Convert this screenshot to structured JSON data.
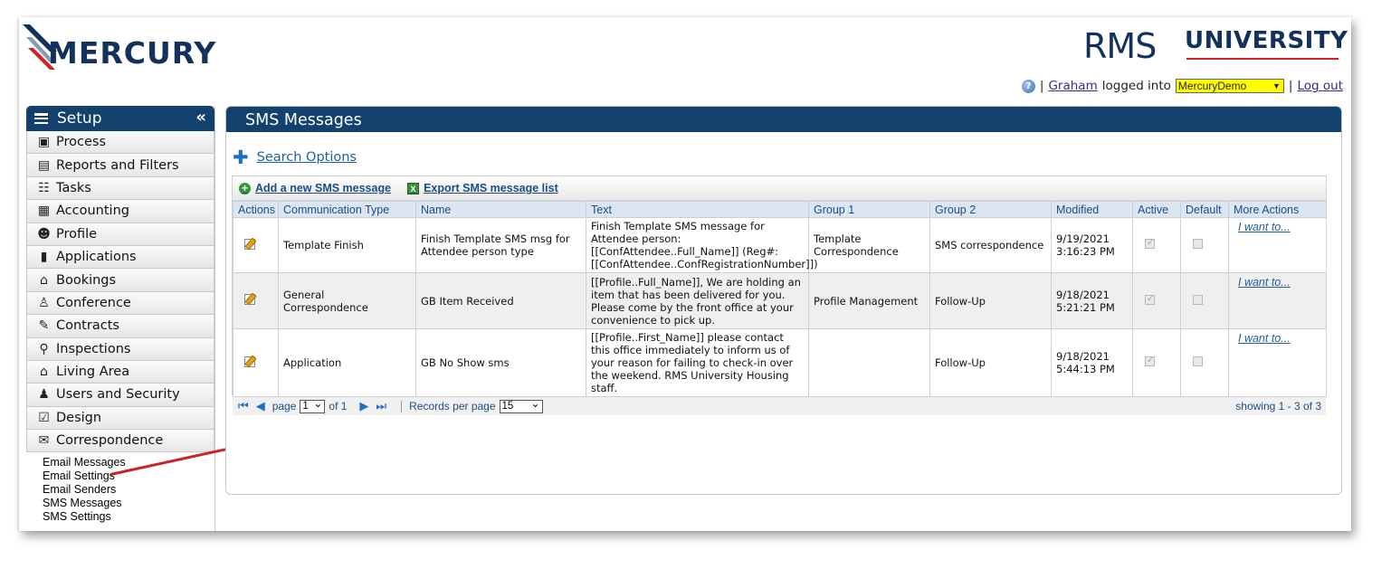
{
  "header": {
    "brand": "MERCURY",
    "partner_logo": "RMS",
    "partner_subtitle": "UNIVERSITY",
    "help_icon": "?",
    "user": "Graham",
    "logged_into": "logged into",
    "database": "MercuryDemo",
    "logout": "Log out",
    "separator": "|"
  },
  "sidebar": {
    "title": "Setup",
    "collapse_icon": "«",
    "items": [
      {
        "label": "Process",
        "icon": "process-icon"
      },
      {
        "label": "Reports and Filters",
        "icon": "report-icon"
      },
      {
        "label": "Tasks",
        "icon": "tasks-icon"
      },
      {
        "label": "Accounting",
        "icon": "calculator-icon"
      },
      {
        "label": "Profile",
        "icon": "people-icon"
      },
      {
        "label": "Applications",
        "icon": "clipboard-icon"
      },
      {
        "label": "Bookings",
        "icon": "house-icon"
      },
      {
        "label": "Conference",
        "icon": "group-icon"
      },
      {
        "label": "Contracts",
        "icon": "contract-icon"
      },
      {
        "label": "Inspections",
        "icon": "magnifier-icon"
      },
      {
        "label": "Living Area",
        "icon": "building-icon"
      },
      {
        "label": "Users and Security",
        "icon": "user-lock-icon"
      },
      {
        "label": "Design",
        "icon": "design-icon"
      },
      {
        "label": "Correspondence",
        "icon": "envelope-icon"
      }
    ],
    "sub_items": [
      "Email Messages",
      "Email Settings",
      "Email Senders",
      "SMS Messages",
      "SMS Settings"
    ]
  },
  "main": {
    "title": "SMS Messages",
    "search_options": "Search Options",
    "toolbar": {
      "add": "Add a new SMS message",
      "export": "Export SMS message list"
    },
    "columns": [
      "Actions",
      "Communication Type",
      "Name",
      "Text",
      "Group 1",
      "Group 2",
      "Modified",
      "Active",
      "Default",
      "More Actions"
    ],
    "rows": [
      {
        "type": "Template Finish",
        "name": "Finish Template SMS msg for Attendee person type",
        "text": "Finish Template SMS message for Attendee person:[[ConfAttendee..Full_Name]] (Reg#: [[ConfAttendee..ConfRegistrationNumber]])",
        "group1": "Template Correspondence",
        "group2": "SMS correspondence",
        "modified_date": "9/19/2021",
        "modified_time": "3:16:23 PM",
        "active": true,
        "default": false,
        "more": "I want to..."
      },
      {
        "type": "General Correspondence",
        "name": "GB Item Received",
        "text": "[[Profile..Full_Name]], We are holding an item that has been delivered for you. Please come by the front office at your convenience to pick up.",
        "group1": "Profile Management",
        "group2": "Follow-Up",
        "modified_date": "9/18/2021",
        "modified_time": "5:21:21 PM",
        "active": true,
        "default": false,
        "more": "I want to..."
      },
      {
        "type": "Application",
        "name": "GB No Show sms",
        "text": "[[Profile..First_Name]] please contact this office immediately to inform us of your reason for failing to check-in over the weekend. RMS University Housing staff.",
        "group1": "",
        "group2": "Follow-Up",
        "modified_date": "9/18/2021",
        "modified_time": "5:44:13 PM",
        "active": true,
        "default": false,
        "more": "I want to..."
      }
    ],
    "pager": {
      "page_label": "page",
      "page_value": "1",
      "of_label": "of 1",
      "records_label": "Records per page",
      "records_value": "15",
      "showing": "showing 1 - 3 of 3"
    }
  },
  "colors": {
    "header_bar": "#12416e",
    "brand_navy": "#12325c",
    "accent_red": "#cc2229",
    "db_select_bg": "#ffff00"
  }
}
